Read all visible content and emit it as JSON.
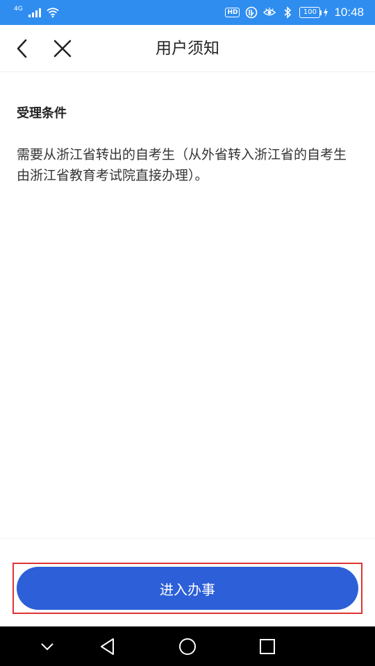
{
  "status_bar": {
    "network_type": "4G",
    "battery_level": "100",
    "time": "10:48",
    "hd_label": "HD",
    "background_color": "#2f8df0"
  },
  "header": {
    "title": "用户须知",
    "back_icon": "chevron-left-icon",
    "close_icon": "close-icon"
  },
  "notice": {
    "section_title": "受理条件",
    "body": "需要从浙江省转出的自考生（从外省转入浙江省的自考生由浙江省教育考试院直接办理）。"
  },
  "action": {
    "label": "进入办事",
    "color": "#2c5fd8"
  },
  "system_nav": {
    "icons": [
      "chevron-down-icon",
      "back-triangle-icon",
      "home-circle-icon",
      "recents-square-icon"
    ]
  }
}
